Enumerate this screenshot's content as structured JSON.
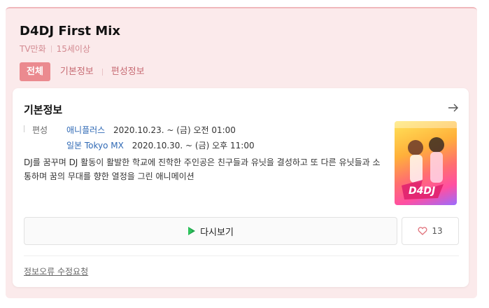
{
  "header": {
    "title": "D4DJ First Mix",
    "meta": [
      "TV만화",
      "15세이상"
    ]
  },
  "tabs": {
    "all": "전체",
    "basic": "기본정보",
    "schedule": "편성정보"
  },
  "basic_info": {
    "section_title": "기본정보",
    "schedule_label": "편성",
    "broadcasts": [
      {
        "channel": "애니플러스",
        "date": "2020.10.23. ~ (금) 오전 01:00"
      },
      {
        "channel": "일본 Tokyo MX",
        "date": "2020.10.30. ~ (금) 오후 11:00"
      }
    ],
    "description": "DJ를 꿈꾸며 DJ 활동이 활발한 학교에 진학한 주인공은 친구들과 유닛을 결성하고 또 다른 유닛들과 소통하며 꿈의 무대를 향한 열정을 그린 애니메이션",
    "replay_label": "다시보기",
    "like_count": "13",
    "report_label": "정보오류 수정요청"
  },
  "icons": {
    "arrow": "arrow-right-icon",
    "play": "play-icon",
    "heart": "heart-icon"
  },
  "colors": {
    "accent": "#eb8a8f",
    "card_bg": "#fbeaeb",
    "link": "#2f69b5"
  }
}
